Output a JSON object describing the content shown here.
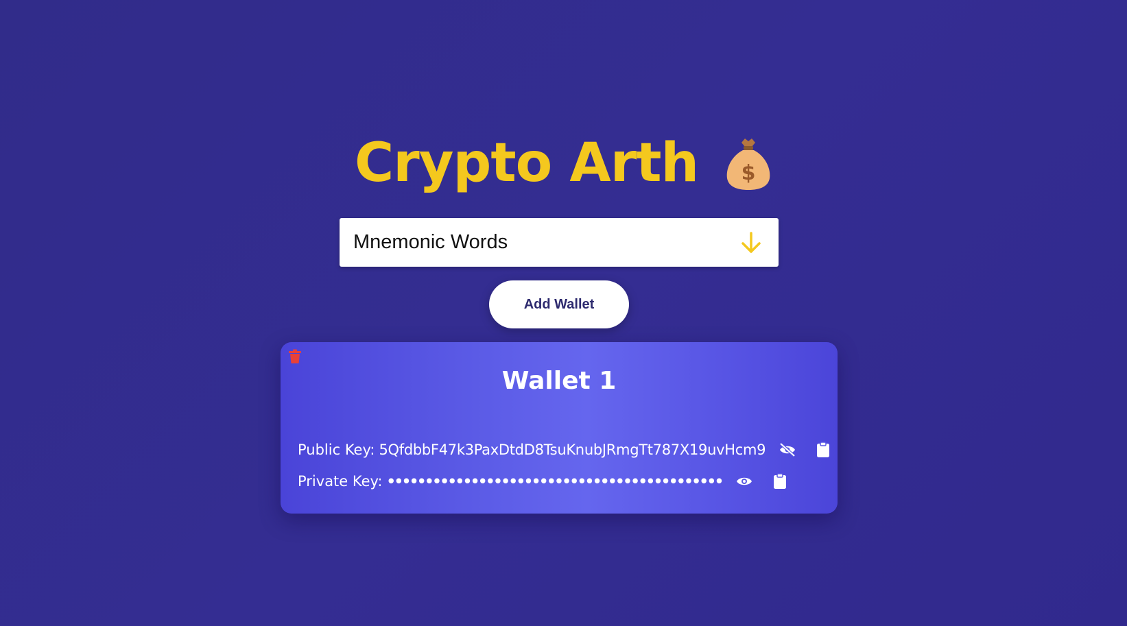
{
  "app": {
    "title": "Crypto Arth",
    "logo_icon": "money-bag-icon",
    "title_color": "#f4c81e"
  },
  "mnemonic": {
    "label": "Mnemonic Words",
    "toggle_icon": "arrow-down-icon"
  },
  "actions": {
    "add_wallet_label": "Add Wallet"
  },
  "wallets": [
    {
      "title": "Wallet 1",
      "delete_icon": "trash-icon",
      "public_key_label": "Public Key:",
      "public_key_value": "5QfdbbF47k3PaxDtdD8TsuKnubJRmgTt787X19uvHcm9",
      "public_visibility_icon": "eye-slash-icon",
      "private_key_label": "Private Key:",
      "private_key_value": "••••••••••••••••••••••••••••••••••••••••••••",
      "private_visibility_icon": "eye-icon",
      "copy_icon": "clipboard-icon"
    }
  ]
}
